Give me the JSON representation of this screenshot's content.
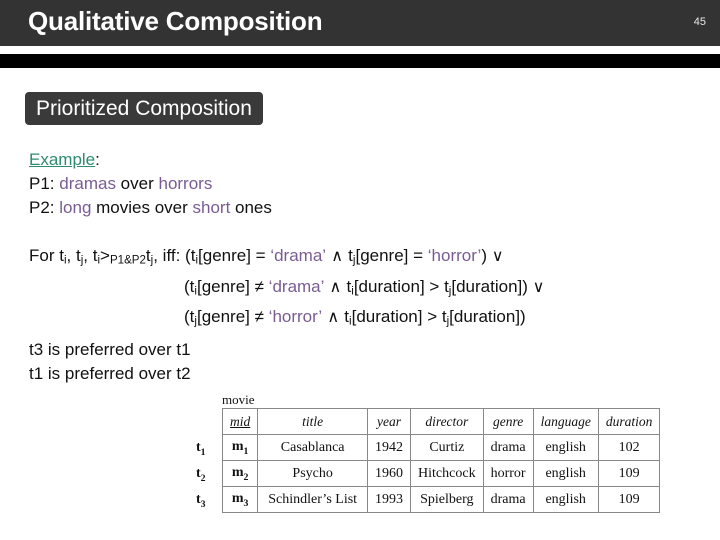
{
  "header": {
    "title": "Qualitative Composition",
    "page_number": "45",
    "bar_color": "#333333",
    "rule_color": "#000000"
  },
  "section": {
    "label": "Prioritized Composition",
    "chip_color": "#3a3a3a"
  },
  "example": {
    "heading": "Example",
    "heading_suffix": ":",
    "heading_color": "#2e8b6f",
    "accent_color": "#7a5c93",
    "lines": [
      {
        "prefix": "P1: ",
        "parts": [
          "dramas",
          " over ",
          "horrors"
        ]
      },
      {
        "prefix": "P2: ",
        "parts": [
          "long",
          " movies over ",
          "short",
          " ones"
        ]
      }
    ],
    "p1_label": "P1:",
    "p1_a": "dramas",
    "p1_mid": " over ",
    "p1_b": "horrors",
    "p2_label": "P2:",
    "p2_a": "long",
    "p2_mid": " movies over ",
    "p2_b": "short",
    "p2_tail": " ones"
  },
  "formula": {
    "lead": "For t",
    "lead_sub_i": "i",
    "lead_c1": ", t",
    "lead_sub_j": "j",
    "lead_c2": ", t",
    "lead_sub_i2": "i",
    "gt": ">",
    "pref_sub": "P1&P2",
    "lead_c3": "t",
    "lead_sub_j2": "j",
    "lead_c4": ", iff: (t",
    "l1_sub_i": "i",
    "l1_a": "[genre] = ",
    "l1_lit1": "‘drama’",
    "l1_and": " ∧ ",
    "l1_t": "t",
    "l1_sub_j": "j",
    "l1_b": "[genre] = ",
    "l1_lit2": "‘horror’",
    "l1_close": ") ",
    "l1_or": "∨",
    "l2_open": "(t",
    "l2_sub_i": "i",
    "l2_a": "[genre] ≠ ",
    "l2_lit": "‘drama’",
    "l2_and": " ∧ ",
    "l2_t1": "t",
    "l2_sub_i2": "i",
    "l2_b": "[duration] > t",
    "l2_sub_j": "j",
    "l2_c": "[duration]) ",
    "l2_or": "∨",
    "l3_open": "(t",
    "l3_sub_j": "j",
    "l3_a": "[genre] ≠ ",
    "l3_lit": "‘horror’",
    "l3_and": " ∧ ",
    "l3_t1": "t",
    "l3_sub_i": "i",
    "l3_b": "[duration] > t",
    "l3_sub_j2": "j",
    "l3_c": "[duration])"
  },
  "preferences": {
    "line1": "t3 is preferred over t1",
    "line2": "t1 is preferred over t2"
  },
  "relation": {
    "name": "movie",
    "row_labels": [
      {
        "base": "t",
        "sub": "1"
      },
      {
        "base": "t",
        "sub": "2"
      },
      {
        "base": "t",
        "sub": "3"
      }
    ],
    "columns": [
      "mid",
      "title",
      "year",
      "director",
      "genre",
      "language",
      "duration"
    ],
    "primary_key": "mid",
    "rows": [
      {
        "mid_base": "m",
        "mid_sub": "1",
        "title": "Casablanca",
        "year": "1942",
        "director": "Curtiz",
        "genre": "drama",
        "language": "english",
        "duration": "102"
      },
      {
        "mid_base": "m",
        "mid_sub": "2",
        "title": "Psycho",
        "year": "1960",
        "director": "Hitchcock",
        "genre": "horror",
        "language": "english",
        "duration": "109"
      },
      {
        "mid_base": "m",
        "mid_sub": "3",
        "title": "Schindler’s List",
        "year": "1993",
        "director": "Spielberg",
        "genre": "drama",
        "language": "english",
        "duration": "109"
      }
    ]
  }
}
